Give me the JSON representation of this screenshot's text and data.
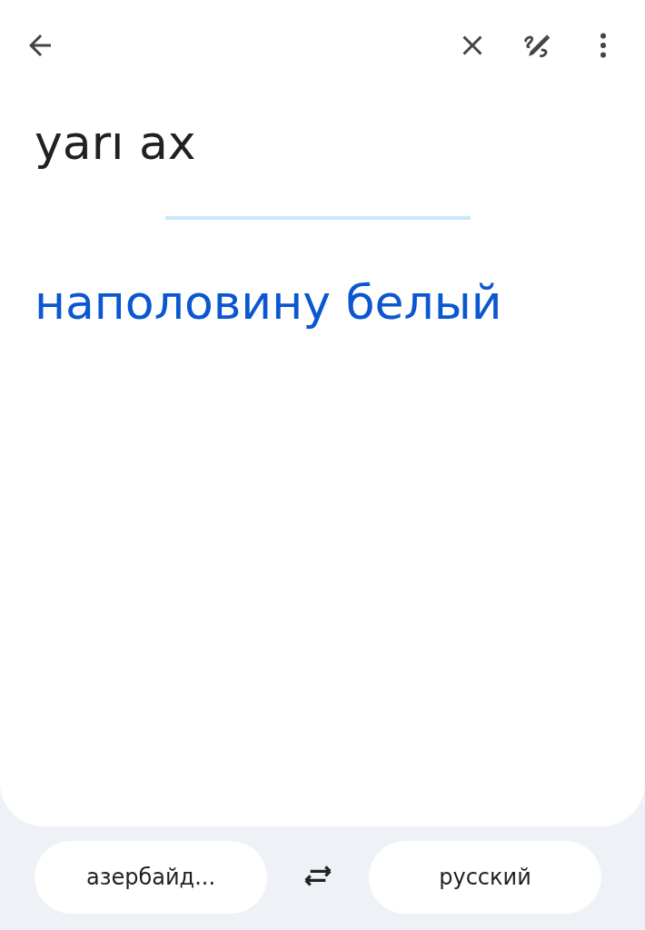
{
  "source_text": "yarı ax",
  "translation": "наполовину белый",
  "languages": {
    "source": "азербайд...",
    "target": "русский"
  }
}
